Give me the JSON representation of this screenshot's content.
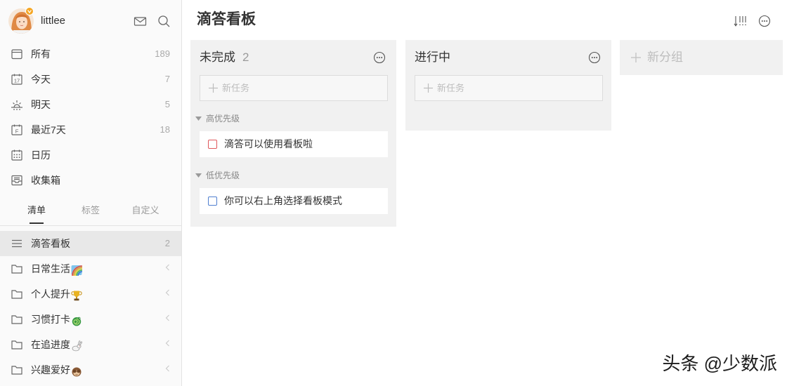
{
  "sidebar": {
    "user": {
      "name": "littlee",
      "avatar_icon": "avatar-icon",
      "badge_icon": "premium-badge-icon"
    },
    "header_icons": [
      "mail-icon",
      "search-icon"
    ],
    "smart_lists": [
      {
        "label": "所有",
        "count": "189",
        "icon": "all-tasks-icon"
      },
      {
        "label": "今天",
        "count": "7",
        "icon": "today-calendar-icon",
        "icon_text": "17"
      },
      {
        "label": "明天",
        "count": "5",
        "icon": "sunrise-icon"
      },
      {
        "label": "最近7天",
        "count": "18",
        "icon": "week-calendar-icon",
        "icon_text": "F"
      },
      {
        "label": "日历",
        "icon": "calendar-grid-icon"
      },
      {
        "label": "收集箱",
        "icon": "inbox-icon"
      }
    ],
    "tabs": [
      {
        "label": "清单",
        "active": true
      },
      {
        "label": "标签",
        "active": false
      },
      {
        "label": "自定义",
        "active": false
      }
    ],
    "lists": [
      {
        "label": "滴答看板",
        "count": "2",
        "icon": "menu-icon",
        "selected": true
      },
      {
        "label": "日常生活",
        "icon": "folder-icon",
        "emoji": "rainbow-emoji",
        "collapsed": true
      },
      {
        "label": "个人提升",
        "icon": "folder-icon",
        "emoji": "trophy-emoji",
        "collapsed": true
      },
      {
        "label": "习惯打卡",
        "icon": "folder-icon",
        "emoji": "dragon-emoji",
        "collapsed": true
      },
      {
        "label": "在追进度",
        "icon": "folder-icon",
        "emoji": "rabbit-emoji",
        "collapsed": true
      },
      {
        "label": "兴趣爱好",
        "icon": "folder-icon",
        "emoji": "see-no-evil-monkey-emoji",
        "collapsed": true
      }
    ]
  },
  "main": {
    "title": "滴答看板",
    "toolbar_icons": [
      "sort-by-priority-icon",
      "more-options-icon"
    ],
    "columns": [
      {
        "name": "未完成",
        "count": "2",
        "new_task_placeholder": "新任务",
        "groups": [
          {
            "label": "高优先级",
            "expanded": true,
            "tasks": [
              {
                "title": "滴答可以使用看板啦",
                "checkbox_color": "#e0575b",
                "done": false
              }
            ]
          },
          {
            "label": "低优先级",
            "expanded": true,
            "tasks": [
              {
                "title": "你可以右上角选择看板模式",
                "checkbox_color": "#4f7fd0",
                "done": false
              }
            ]
          }
        ]
      },
      {
        "name": "进行中",
        "new_task_placeholder": "新任务",
        "groups": []
      }
    ],
    "new_group_label": "新分组"
  },
  "watermark": "头条 @少数派",
  "colors": {
    "sidebar_bg": "#fafafa",
    "selected_row": "#e8e8e8",
    "column_bg": "#f1f1f1",
    "text": "#333333",
    "muted": "#aaaaaa",
    "priority_high": "#e0575b",
    "priority_low": "#4f7fd0",
    "avatar_badge": "#f5a623"
  }
}
